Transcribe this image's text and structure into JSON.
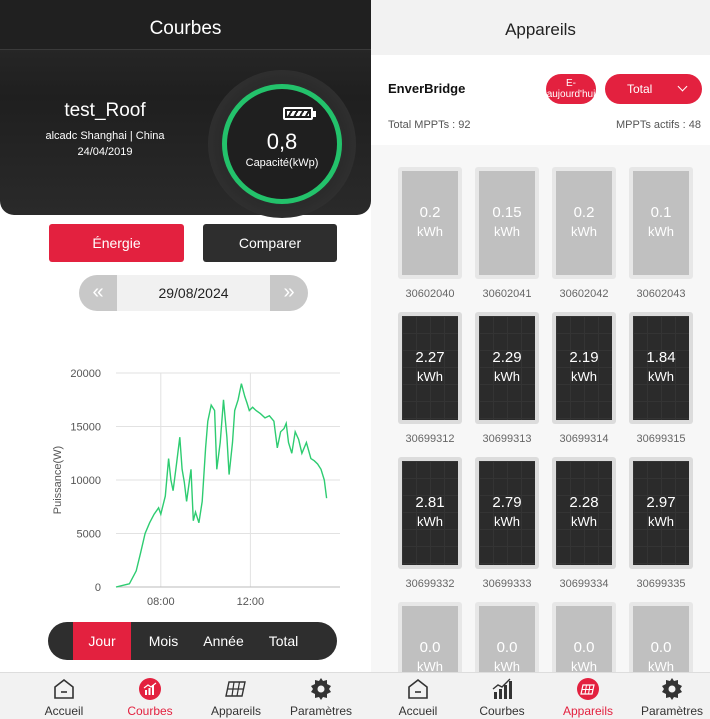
{
  "left": {
    "title": "Courbes",
    "site": {
      "name": "test_Roof",
      "location": "alcadc Shanghai | China",
      "date": "24/04/2019"
    },
    "capacity": {
      "value": "0,8",
      "label": "Capacité(kWp)",
      "icon": "battery-icon"
    },
    "buttons": {
      "energy": "Énergie",
      "compare": "Comparer"
    },
    "date_nav": {
      "prev": "«",
      "date": "29/08/2024",
      "next": "»"
    },
    "periods": [
      "Jour",
      "Mois",
      "Année",
      "Total"
    ],
    "active_period": "Jour"
  },
  "chart_data": {
    "type": "line",
    "title": "",
    "xlabel": "",
    "ylabel": "Puissance(W)",
    "ylim": [
      0,
      20000
    ],
    "yticks": [
      0,
      5000,
      10000,
      15000,
      20000
    ],
    "xticks": [
      "08:00",
      "12:00"
    ],
    "xlim_hours": [
      6,
      16
    ],
    "grid": true,
    "color": "#2ecc71",
    "series": [
      {
        "x": [
          6.0,
          6.6,
          6.9,
          7.1,
          7.3,
          7.5,
          7.7,
          7.9,
          8.0,
          8.2,
          8.35,
          8.45,
          8.55,
          8.7,
          8.85,
          8.95,
          9.05,
          9.15,
          9.25,
          9.35,
          9.45,
          9.55,
          9.7,
          9.85,
          10.0,
          10.1,
          10.25,
          10.4,
          10.5,
          10.65,
          10.8,
          10.95,
          11.05,
          11.2,
          11.3,
          11.45,
          11.6,
          11.75,
          11.85,
          11.95,
          12.1,
          12.25,
          12.45,
          12.65,
          12.85,
          13.05,
          13.2,
          13.35,
          13.5,
          13.6,
          13.7,
          13.85,
          14.0,
          14.15,
          14.3,
          14.5,
          14.7,
          14.85,
          15.0,
          15.15,
          15.3,
          15.4
        ],
        "y": [
          0,
          300,
          1500,
          3200,
          5000,
          6000,
          6800,
          7400,
          6800,
          8500,
          12000,
          10000,
          9000,
          11500,
          14000,
          11000,
          9800,
          8000,
          9500,
          11000,
          6200,
          7000,
          6000,
          8000,
          13000,
          15500,
          17000,
          16500,
          11000,
          13500,
          17500,
          14000,
          10500,
          13500,
          16500,
          17500,
          19000,
          17800,
          17200,
          16500,
          16800,
          16500,
          16200,
          15800,
          16000,
          15500,
          13000,
          14500,
          14800,
          15300,
          13500,
          12500,
          14500,
          13800,
          12500,
          13500,
          12000,
          11800,
          11500,
          11000,
          10000,
          8300
        ]
      }
    ]
  },
  "right": {
    "title": "Appareils",
    "device": "EnverBridge",
    "today_btn": "E-aujourd'hui",
    "total_btn": "Total",
    "mppt_total": "Total MPPTs : 92",
    "mppt_active": "MPPTs actifs : 48",
    "panels": [
      {
        "value": "0.2",
        "unit": "kWh",
        "id": "30602040",
        "status": "offline"
      },
      {
        "value": "0.15",
        "unit": "kWh",
        "id": "30602041",
        "status": "offline"
      },
      {
        "value": "0.2",
        "unit": "kWh",
        "id": "30602042",
        "status": "offline"
      },
      {
        "value": "0.1",
        "unit": "kWh",
        "id": "30602043",
        "status": "offline"
      },
      {
        "value": "2.27",
        "unit": "kWh",
        "id": "30699312",
        "status": "online"
      },
      {
        "value": "2.29",
        "unit": "kWh",
        "id": "30699313",
        "status": "online"
      },
      {
        "value": "2.19",
        "unit": "kWh",
        "id": "30699314",
        "status": "online"
      },
      {
        "value": "1.84",
        "unit": "kWh",
        "id": "30699315",
        "status": "online"
      },
      {
        "value": "2.81",
        "unit": "kWh",
        "id": "30699332",
        "status": "online"
      },
      {
        "value": "2.79",
        "unit": "kWh",
        "id": "30699333",
        "status": "online"
      },
      {
        "value": "2.28",
        "unit": "kWh",
        "id": "30699334",
        "status": "online"
      },
      {
        "value": "2.97",
        "unit": "kWh",
        "id": "30699335",
        "status": "online"
      },
      {
        "value": "0.0",
        "unit": "kWh",
        "id": "",
        "status": "offline"
      },
      {
        "value": "0.0",
        "unit": "kWh",
        "id": "",
        "status": "offline"
      },
      {
        "value": "0.0",
        "unit": "kWh",
        "id": "",
        "status": "offline"
      },
      {
        "value": "0.0",
        "unit": "kWh",
        "id": "",
        "status": "offline"
      }
    ]
  },
  "tabbar": {
    "left_active": "Courbes",
    "right_active": "Appareils",
    "items": [
      {
        "label": "Accueil",
        "icon": "home-icon"
      },
      {
        "label": "Courbes",
        "icon": "chart-icon"
      },
      {
        "label": "Appareils",
        "icon": "solar-panel-icon"
      },
      {
        "label": "Paramètres",
        "icon": "gear-icon"
      }
    ]
  },
  "colors": {
    "accent": "#e3213f",
    "gauge": "#23c26b",
    "line": "#2ecc71",
    "dark": "#2e2e2e"
  }
}
